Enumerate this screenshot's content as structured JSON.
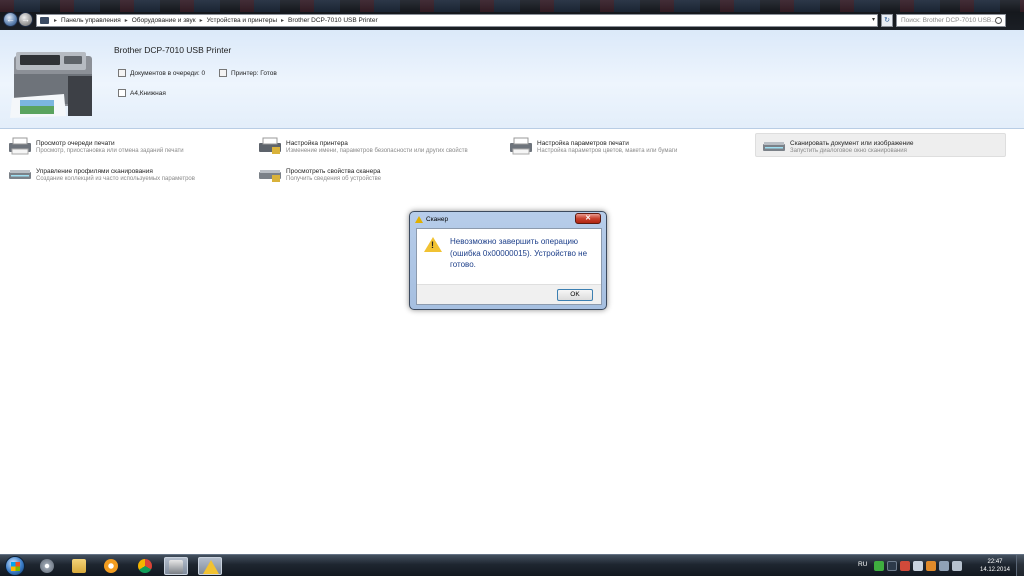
{
  "address_bar": {
    "crumbs": [
      "Панель управления",
      "Оборудование и звук",
      "Устройства и принтеры",
      "Brother DCP-7010 USB Printer"
    ],
    "search_placeholder": "Поиск: Brother DCP-7010 USB..."
  },
  "device": {
    "name": "Brother DCP-7010 USB Printer",
    "queue": "Документов в очереди: 0",
    "status": "Принтер: Готов",
    "paper": "A4,Книжная"
  },
  "tasks": [
    {
      "title": "Просмотр очереди печати",
      "desc": "Просмотр, приостановка или отмена заданий печати"
    },
    {
      "title": "Настройка принтера",
      "desc": "Изменение имени, параметров безопасности или других свойств"
    },
    {
      "title": "Настройка параметров печати",
      "desc": "Настройка параметров цветов, макета или бумаги"
    },
    {
      "title": "Сканировать документ или изображение",
      "desc": "Запустить диалоговое окно сканирования"
    },
    {
      "title": "Управление профилями сканирования",
      "desc": "Создание коллекций из часто используемых параметров"
    },
    {
      "title": "Просмотреть свойства сканера",
      "desc": "Получить сведения об устройстве"
    }
  ],
  "dialog": {
    "title": "Сканер",
    "message": "Невозможно завершить операцию (ошибка 0x00000015). Устройство не готово.",
    "ok_label": "OK"
  },
  "taskbar": {
    "language": "RU",
    "time": "22:47",
    "date": "14.12.2014"
  }
}
